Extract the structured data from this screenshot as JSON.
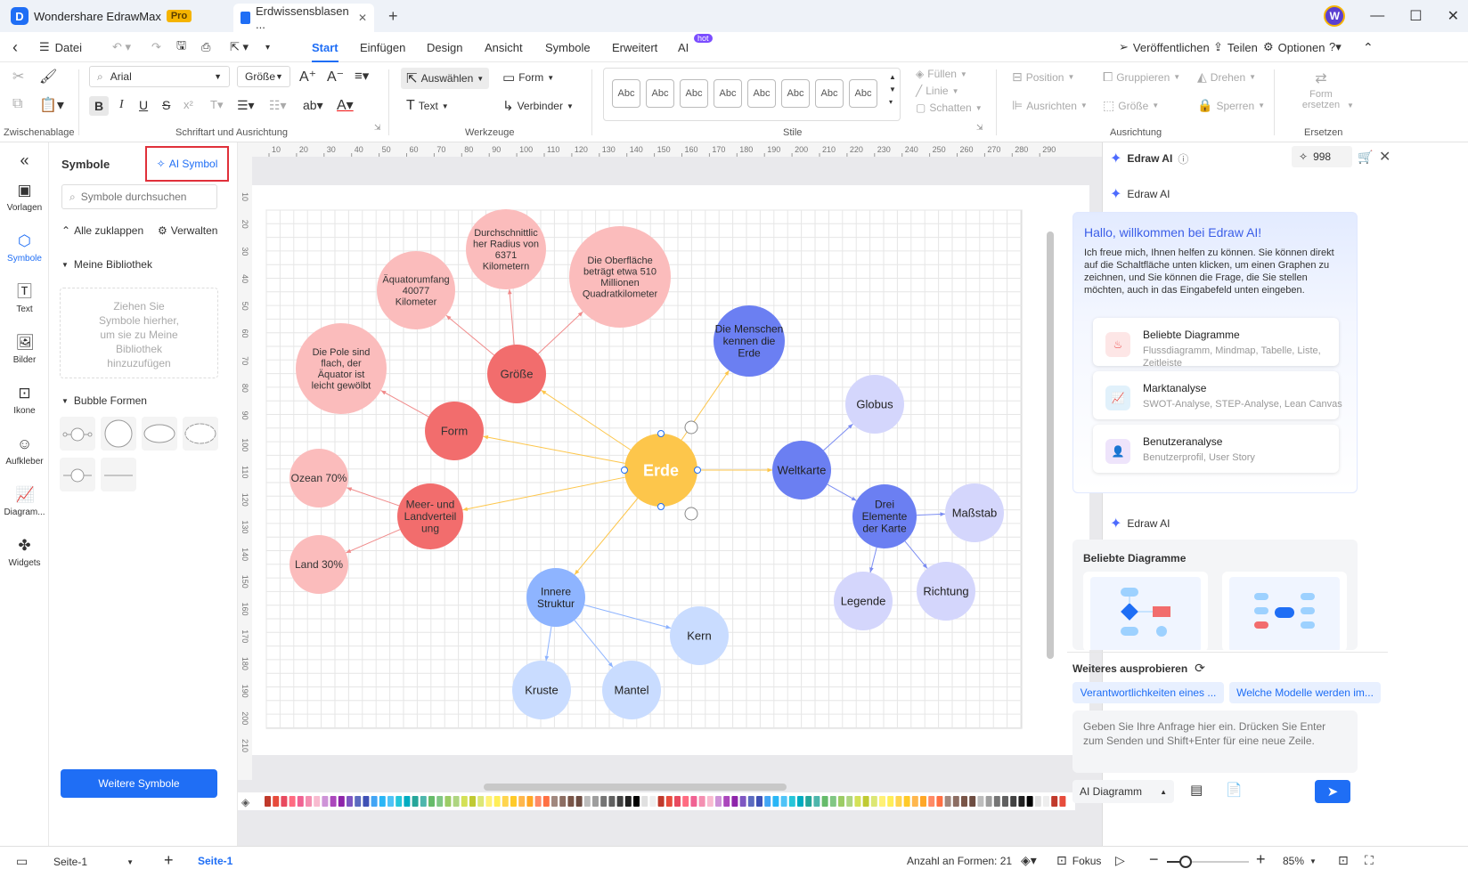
{
  "window": {
    "app_name": "Wondershare EdrawMax",
    "badge": "Pro",
    "doc_tab": "Erdwissensblasen ...",
    "user_initial": "W",
    "tab_close": "✕",
    "new_tab": "+",
    "minimize": "—",
    "maximize": "☐",
    "close": "✕"
  },
  "menubar": {
    "back": "‹",
    "file": "Datei",
    "tabs": [
      "Start",
      "Einfügen",
      "Design",
      "Ansicht",
      "Symbole",
      "Erweitert",
      "AI"
    ],
    "ai_hot": "hot",
    "publish": "Veröffentlichen",
    "share": "Teilen",
    "options": "Optionen"
  },
  "ribbon": {
    "font": "Arial",
    "size": "Größe",
    "select": "Auswählen",
    "shape": "Form",
    "text": "Text",
    "connector": "Verbinder",
    "style_samples": [
      "Abc",
      "Abc",
      "Abc",
      "Abc",
      "Abc",
      "Abc",
      "Abc",
      "Abc"
    ],
    "fill": "Füllen",
    "line": "Linie",
    "shadow": "Schatten",
    "position": "Position",
    "align": "Ausrichten",
    "group": "Gruppieren",
    "rotate": "Drehen",
    "lock": "Sperren",
    "replace_shape": "Form ersetzen",
    "groups": [
      "Zwischenablage",
      "Schriftart und Ausrichtung",
      "Werkzeuge",
      "Stile",
      "Ausrichtung",
      "Ersetzen"
    ]
  },
  "rail": [
    "Vorlagen",
    "Symbole",
    "Text",
    "Bilder",
    "Ikone",
    "Aufkleber",
    "Diagram...",
    "Widgets"
  ],
  "symbols": {
    "title": "Symbole",
    "ai_symbol": "AI Symbol",
    "search_placeholder": "Symbole durchsuchen",
    "collapse_all": "Alle zuklappen",
    "manage": "Verwalten",
    "my_library": "Meine Bibliothek",
    "drop_hint": "Ziehen Sie Symbole hierher, um sie zu Meine Bibliothek hinzuzufügen",
    "bubble_shapes": "Bubble Formen",
    "more_symbols": "Weitere Symbole"
  },
  "ruler_h": [
    "10",
    "20",
    "30",
    "40",
    "50",
    "60",
    "70",
    "80",
    "90",
    "100",
    "110",
    "120",
    "130",
    "140",
    "150",
    "160",
    "170",
    "180",
    "190",
    "200",
    "210",
    "220",
    "230",
    "240",
    "250",
    "260",
    "270",
    "280",
    "290"
  ],
  "ruler_v": [
    "10",
    "20",
    "30",
    "40",
    "50",
    "60",
    "70",
    "80",
    "90",
    "100",
    "110",
    "120",
    "130",
    "140",
    "150",
    "160",
    "170",
    "180",
    "190",
    "200",
    "210"
  ],
  "diagram": {
    "center": "Erde",
    "nodes": {
      "groesse": "Größe",
      "form": "Form",
      "meer": "Meer- und Landverteil ung",
      "radius": "Durchschnittlic her Radius von 6371 Kilometern",
      "oberflaeche": "Die Oberfläche beträgt etwa 510 Millionen Quadratkilometer",
      "aequator": "Äquatorumfang 40077 Kilometer",
      "pole": "Die Pole sind flach, der Äquator ist leicht gewölbt",
      "ozean": "Ozean 70%",
      "land": "Land 30%",
      "menschen": "Die Menschen kennen die Erde",
      "weltkarte": "Weltkarte",
      "globus": "Globus",
      "drei": "Drei Elemente der Karte",
      "massstab": "Maßstab",
      "legende": "Legende",
      "richtung": "Richtung",
      "innere": "Innere Struktur",
      "kern": "Kern",
      "kruste": "Kruste",
      "mantel": "Mantel"
    }
  },
  "ai": {
    "title": "Edraw AI",
    "credits": "998",
    "section_label": "Edraw AI",
    "welcome": "Hallo, willkommen bei Edraw AI!",
    "intro": "Ich freue mich, Ihnen helfen zu können. Sie können direkt auf die Schaltfläche unten klicken, um einen Graphen zu zeichnen, und Sie können die Frage, die Sie stellen möchten, auch in das Eingabefeld unten eingeben.",
    "cards": [
      {
        "title": "Beliebte Diagramme",
        "sub": "Flussdiagramm, Mindmap, Tabelle, Liste, Zeitleiste"
      },
      {
        "title": "Marktanalyse",
        "sub": "SWOT-Analyse, STEP-Analyse, Lean Canvas"
      },
      {
        "title": "Benutzeranalyse",
        "sub": "Benutzerprofil, User Story"
      }
    ],
    "popular": "Beliebte Diagramme",
    "try_more": "Weiteres ausprobieren",
    "chips": [
      "Verantwortlichkeiten eines ...",
      "Welche Modelle werden im..."
    ],
    "input_placeholder": "Geben Sie Ihre Anfrage hier ein. Drücken Sie Enter zum Senden und Shift+Enter für eine neue Zeile.",
    "mode": "AI Diagramm"
  },
  "status": {
    "page_selector": "Seite-1",
    "page_tab": "Seite-1",
    "shape_count": "Anzahl an Formen: 21",
    "focus": "Fokus",
    "zoom": "85%"
  },
  "colors": {
    "accent": "#1f6ef5",
    "red_dark": "#f26d6d",
    "red_light": "#fbbcbc",
    "orange": "#fdc64b",
    "blue_dark": "#6b7ff2",
    "blue_light": "#d4d6fc",
    "blue_mid": "#8eb4ff",
    "blue_pale": "#c9dcff"
  }
}
